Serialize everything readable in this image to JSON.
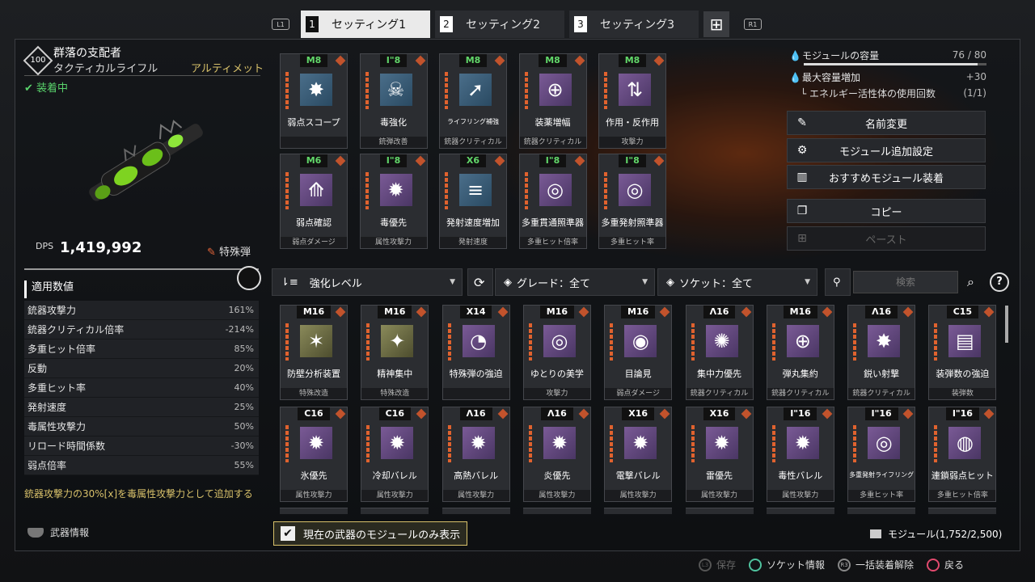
{
  "tabs": {
    "l1": "L1",
    "r1": "R1",
    "items": [
      {
        "num": "1",
        "label": "セッティング1",
        "active": true
      },
      {
        "num": "2",
        "label": "セッティング2",
        "active": false
      },
      {
        "num": "3",
        "label": "セッティング3",
        "active": false
      }
    ]
  },
  "weapon": {
    "level": "100",
    "name": "群落の支配者",
    "type": "タクティカルライフル",
    "rarity": "アルティメット",
    "equipped": "装着中",
    "dps_label": "DPS",
    "dps_value": "1,419,992",
    "ammo": "特殊弾",
    "stats_header": "適用数値",
    "stats": [
      {
        "label": "銃器攻撃力",
        "value": "161%"
      },
      {
        "label": "銃器クリティカル倍率",
        "value": "-214%"
      },
      {
        "label": "多重ヒット倍率",
        "value": "85%"
      },
      {
        "label": "反動",
        "value": "20%"
      },
      {
        "label": "多重ヒット率",
        "value": "40%"
      },
      {
        "label": "発射速度",
        "value": "25%"
      },
      {
        "label": "毒属性攻撃力",
        "value": "50%"
      },
      {
        "label": "リロード時間係数",
        "value": "-30%"
      },
      {
        "label": "弱点倍率",
        "value": "55%"
      }
    ],
    "effect": "銃器攻撃力の30%[x]を毒属性攻撃力として追加する",
    "info_label": "武器情報"
  },
  "equipped_modules": [
    {
      "cost": "M8",
      "name": "弱点スコープ",
      "cat": "",
      "icon": "✸",
      "color": "blue",
      "green": true
    },
    {
      "cost": "I\"8",
      "name": "毒強化",
      "cat": "銃弾改善",
      "icon": "☠",
      "color": "blue",
      "green": true
    },
    {
      "cost": "M8",
      "name": "ライフリング補強",
      "cat": "銃器クリティカル",
      "icon": "➚",
      "color": "blue",
      "green": true,
      "small": true
    },
    {
      "cost": "M8",
      "name": "装薬増幅",
      "cat": "銃器クリティカル",
      "icon": "⊕",
      "color": "purple",
      "green": true
    },
    {
      "cost": "M8",
      "name": "作用・反作用",
      "cat": "攻撃力",
      "icon": "⇅",
      "color": "purple",
      "green": true
    },
    {
      "cost": "M6",
      "name": "弱点確認",
      "cat": "弱点ダメージ",
      "icon": "⟰",
      "color": "purple",
      "green": true
    },
    {
      "cost": "I\"8",
      "name": "毒優先",
      "cat": "属性攻撃力",
      "icon": "✹",
      "color": "purple",
      "green": true
    },
    {
      "cost": "X6",
      "name": "発射速度増加",
      "cat": "発射速度",
      "icon": "≡",
      "color": "blue",
      "green": true
    },
    {
      "cost": "I\"8",
      "name": "多重貫通照準器",
      "cat": "多重ヒット倍率",
      "icon": "◎",
      "color": "purple",
      "green": true
    },
    {
      "cost": "I\"8",
      "name": "多重発射照準器",
      "cat": "多重ヒット率",
      "icon": "◎",
      "color": "purple",
      "green": true
    }
  ],
  "capacity": {
    "label": "モジュールの容量",
    "value": "76 / 80",
    "fill": 0.95,
    "max_label": "最大容量増加",
    "max_value": "+30",
    "energy_label": "エネルギー活性体の使用回数",
    "energy_value": "(1/1)"
  },
  "actions": {
    "rename": "名前変更",
    "module_settings": "モジュール追加設定",
    "recommend": "おすすめモジュール装着",
    "copy": "コピー",
    "paste": "ペースト"
  },
  "filters": {
    "sort": "強化レベル",
    "grade": "グレード：全て",
    "socket": "ソケット：全て",
    "search_placeholder": "検索",
    "help": "?"
  },
  "inventory": [
    {
      "cost": "M16",
      "name": "防壁分析装置",
      "cat": "特殊改造",
      "icon": "✶",
      "color": "olive"
    },
    {
      "cost": "M16",
      "name": "精神集中",
      "cat": "特殊改造",
      "icon": "✦",
      "color": "olive"
    },
    {
      "cost": "X14",
      "name": "特殊弾の強迫",
      "cat": "",
      "icon": "◔",
      "color": "purple"
    },
    {
      "cost": "M16",
      "name": "ゆとりの美学",
      "cat": "攻撃力",
      "icon": "◎",
      "color": "purple"
    },
    {
      "cost": "M16",
      "name": "目論見",
      "cat": "弱点ダメージ",
      "icon": "◉",
      "color": "purple"
    },
    {
      "cost": "Λ16",
      "name": "集中力優先",
      "cat": "銃器クリティカル",
      "icon": "✺",
      "color": "purple"
    },
    {
      "cost": "M16",
      "name": "弾丸集約",
      "cat": "銃器クリティカル",
      "icon": "⊕",
      "color": "purple"
    },
    {
      "cost": "Λ16",
      "name": "鋭い射撃",
      "cat": "銃器クリティカル",
      "icon": "✸",
      "color": "purple"
    },
    {
      "cost": "C15",
      "name": "装弾数の強迫",
      "cat": "装弾数",
      "icon": "▤",
      "color": "purple"
    },
    {
      "cost": "C16",
      "name": "氷優先",
      "cat": "属性攻撃力",
      "icon": "✹",
      "color": "purple"
    },
    {
      "cost": "C16",
      "name": "冷却バレル",
      "cat": "属性攻撃力",
      "icon": "✹",
      "color": "purple"
    },
    {
      "cost": "Λ16",
      "name": "高熱バレル",
      "cat": "属性攻撃力",
      "icon": "✹",
      "color": "purple"
    },
    {
      "cost": "Λ16",
      "name": "炎優先",
      "cat": "属性攻撃力",
      "icon": "✹",
      "color": "purple"
    },
    {
      "cost": "X16",
      "name": "電撃バレル",
      "cat": "属性攻撃力",
      "icon": "✹",
      "color": "purple"
    },
    {
      "cost": "X16",
      "name": "雷優先",
      "cat": "属性攻撃力",
      "icon": "✹",
      "color": "purple"
    },
    {
      "cost": "I\"16",
      "name": "毒性バレル",
      "cat": "属性攻撃力",
      "icon": "✹",
      "color": "purple"
    },
    {
      "cost": "I\"16",
      "name": "多重発射ライフリング",
      "cat": "多重ヒット率",
      "icon": "◎",
      "color": "purple",
      "small": true
    },
    {
      "cost": "I\"16",
      "name": "連鎖弱点ヒット",
      "cat": "多重ヒット倍率",
      "icon": "◍",
      "color": "purple"
    }
  ],
  "bottom": {
    "only_current": "現在の武器のモジュールのみ表示",
    "module_count": "モジュール(1,752/2,500)",
    "save": "保存",
    "socket_info": "ソケット情報",
    "unequip_all": "一括装着解除",
    "back": "戻る",
    "l3": "L3",
    "r3": "R3"
  }
}
